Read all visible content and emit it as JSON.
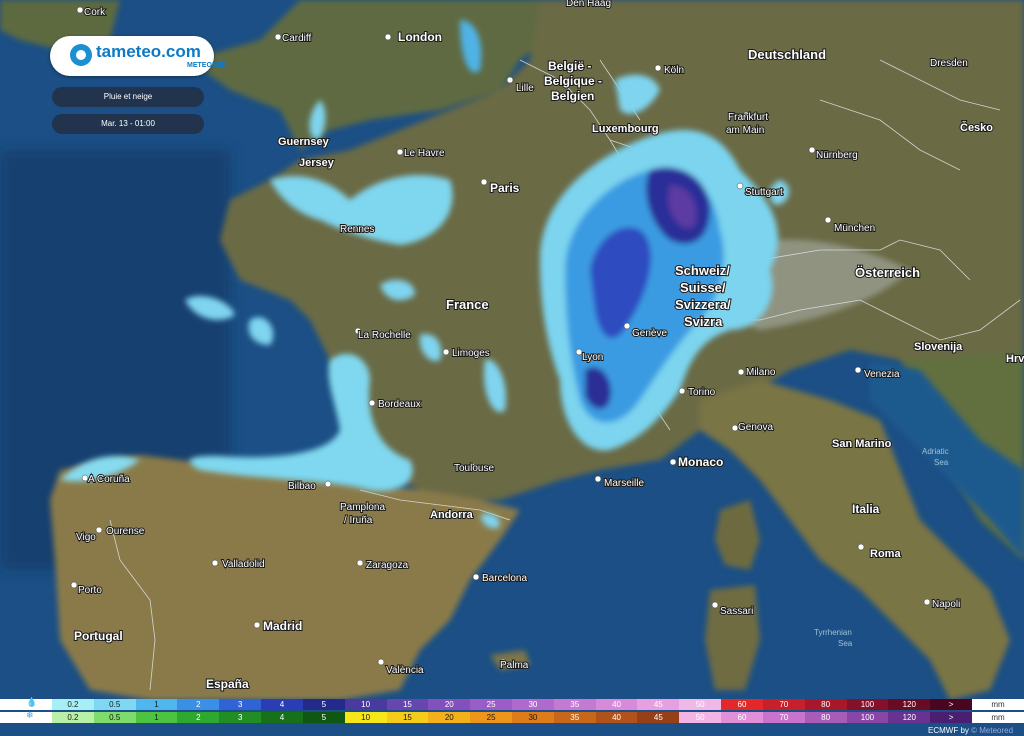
{
  "brand": {
    "name": "tameteo.com",
    "sub": "METEORED"
  },
  "layer_label": "Pluie et neige",
  "time_label": "Mar. 13 - 01:00",
  "credit": {
    "prefix": "ECMWF by ",
    "brand": "© Meteored"
  },
  "colors": {
    "sea": "#1b4f85",
    "land": "#6a6a45",
    "rain_light": "#8fe0f0",
    "rain_mid": "#3aa8ea",
    "rain_heavy": "#3b2f9a"
  },
  "places": [
    {
      "name": "Cork",
      "bold": false
    },
    {
      "name": "Cardiff",
      "bold": false
    },
    {
      "name": "London",
      "bold": true
    },
    {
      "name": "Den Haag",
      "bold": false
    },
    {
      "name": "Deutschland",
      "bold": true
    },
    {
      "name": "Dresden",
      "bold": false
    },
    {
      "name": "België -",
      "bold": true
    },
    {
      "name": "Belgique -",
      "bold": true
    },
    {
      "name": "Belgien",
      "bold": true
    },
    {
      "name": "Lille",
      "bold": false
    },
    {
      "name": "Köln",
      "bold": false
    },
    {
      "name": "Luxembourg",
      "bold": true
    },
    {
      "name": "Frankfurt",
      "bold": false
    },
    {
      "name": "am Main",
      "bold": false
    },
    {
      "name": "Česko",
      "bold": true
    },
    {
      "name": "Guernsey",
      "bold": true
    },
    {
      "name": "Jersey",
      "bold": true
    },
    {
      "name": "Le Havre",
      "bold": false
    },
    {
      "name": "Paris",
      "bold": true
    },
    {
      "name": "Nürnberg",
      "bold": false
    },
    {
      "name": "Stuttgart",
      "bold": false
    },
    {
      "name": "Rennes",
      "bold": false
    },
    {
      "name": "München",
      "bold": false
    },
    {
      "name": "Schweiz/",
      "bold": true
    },
    {
      "name": "Suisse/",
      "bold": true
    },
    {
      "name": "Svizzera/",
      "bold": true
    },
    {
      "name": "Svizra",
      "bold": true
    },
    {
      "name": "Österreich",
      "bold": true
    },
    {
      "name": "France",
      "bold": true
    },
    {
      "name": "La Rochelle",
      "bold": false
    },
    {
      "name": "Genève",
      "bold": false
    },
    {
      "name": "Slovenija",
      "bold": true
    },
    {
      "name": "Limoges",
      "bold": false
    },
    {
      "name": "Lyon",
      "bold": false
    },
    {
      "name": "Milano",
      "bold": false
    },
    {
      "name": "Venezia",
      "bold": false
    },
    {
      "name": "Bordeaux",
      "bold": false
    },
    {
      "name": "Torino",
      "bold": false
    },
    {
      "name": "Genova",
      "bold": false
    },
    {
      "name": "San Marino",
      "bold": true
    },
    {
      "name": "Adriatic",
      "bold": false
    },
    {
      "name": "Sea",
      "bold": false
    },
    {
      "name": "Toulouse",
      "bold": false
    },
    {
      "name": "Monaco",
      "bold": true
    },
    {
      "name": "Marseille",
      "bold": false
    },
    {
      "name": "A Coruña",
      "bold": false
    },
    {
      "name": "Bilbao",
      "bold": false
    },
    {
      "name": "Pamplona",
      "bold": false
    },
    {
      "name": "/ Iruña",
      "bold": false
    },
    {
      "name": "Andorra",
      "bold": true
    },
    {
      "name": "Italia",
      "bold": true
    },
    {
      "name": "Ourense",
      "bold": false
    },
    {
      "name": "Vigo",
      "bold": false
    },
    {
      "name": "Valladolid",
      "bold": false
    },
    {
      "name": "Zaragoza",
      "bold": false
    },
    {
      "name": "Barcelona",
      "bold": false
    },
    {
      "name": "Roma",
      "bold": true
    },
    {
      "name": "Porto",
      "bold": false
    },
    {
      "name": "Napoli",
      "bold": false
    },
    {
      "name": "Sassari",
      "bold": false
    },
    {
      "name": "Portugal",
      "bold": true
    },
    {
      "name": "Madrid",
      "bold": true
    },
    {
      "name": "Tyrrhenian",
      "bold": false
    },
    {
      "name": "Sea",
      "bold": false
    },
    {
      "name": "Palma",
      "bold": false
    },
    {
      "name": "València",
      "bold": false
    },
    {
      "name": "España",
      "bold": true
    },
    {
      "name": "Hrv",
      "bold": true
    }
  ],
  "legend": {
    "unit": "mm",
    "rows": [
      {
        "icon": "rain-icon",
        "bins": [
          {
            "label": "0.2",
            "color": "#a6f0f5"
          },
          {
            "label": "0.5",
            "color": "#7fd8f2"
          },
          {
            "label": "1",
            "color": "#4fb6ee"
          },
          {
            "label": "2",
            "color": "#3a8fe6"
          },
          {
            "label": "3",
            "color": "#2f63d6"
          },
          {
            "label": "4",
            "color": "#2a3db5"
          },
          {
            "label": "5",
            "color": "#232a8a"
          },
          {
            "label": "10",
            "color": "#4a3aa0"
          },
          {
            "label": "15",
            "color": "#6846b0"
          },
          {
            "label": "20",
            "color": "#8450bd"
          },
          {
            "label": "25",
            "color": "#9a5cc6"
          },
          {
            "label": "30",
            "color": "#b06acd"
          },
          {
            "label": "35",
            "color": "#c479d3"
          },
          {
            "label": "40",
            "color": "#d68ad8"
          },
          {
            "label": "45",
            "color": "#e6a0df"
          },
          {
            "label": "50",
            "color": "#f0b8e6"
          },
          {
            "label": "60",
            "color": "#e4282a"
          },
          {
            "label": "70",
            "color": "#c8202a"
          },
          {
            "label": "80",
            "color": "#a8182a"
          },
          {
            "label": "100",
            "color": "#86102a"
          },
          {
            "label": "120",
            "color": "#6a0b25"
          },
          {
            "label": ">",
            "color": "#4a0620"
          }
        ]
      },
      {
        "icon": "snow-icon",
        "bins": [
          {
            "label": "0.2",
            "color": "#b8f0a8"
          },
          {
            "label": "0.5",
            "color": "#7ddc6c"
          },
          {
            "label": "1",
            "color": "#4cc43f"
          },
          {
            "label": "2",
            "color": "#2fa830"
          },
          {
            "label": "3",
            "color": "#228c25"
          },
          {
            "label": "4",
            "color": "#17701a"
          },
          {
            "label": "5",
            "color": "#0f5712"
          },
          {
            "label": "10",
            "color": "#f6e61a"
          },
          {
            "label": "15",
            "color": "#f5cc1a"
          },
          {
            "label": "20",
            "color": "#f3b01a"
          },
          {
            "label": "25",
            "color": "#ee961a"
          },
          {
            "label": "30",
            "color": "#de7c1a"
          },
          {
            "label": "35",
            "color": "#c8661a"
          },
          {
            "label": "40",
            "color": "#b0521a"
          },
          {
            "label": "45",
            "color": "#964018"
          },
          {
            "label": "50",
            "color": "#f2b3e5"
          },
          {
            "label": "60",
            "color": "#e08fd8"
          },
          {
            "label": "70",
            "color": "#c874cc"
          },
          {
            "label": "80",
            "color": "#a85cb8"
          },
          {
            "label": "100",
            "color": "#8a46a6"
          },
          {
            "label": "120",
            "color": "#6a3290"
          },
          {
            "label": ">",
            "color": "#4a1e70"
          }
        ]
      }
    ]
  }
}
